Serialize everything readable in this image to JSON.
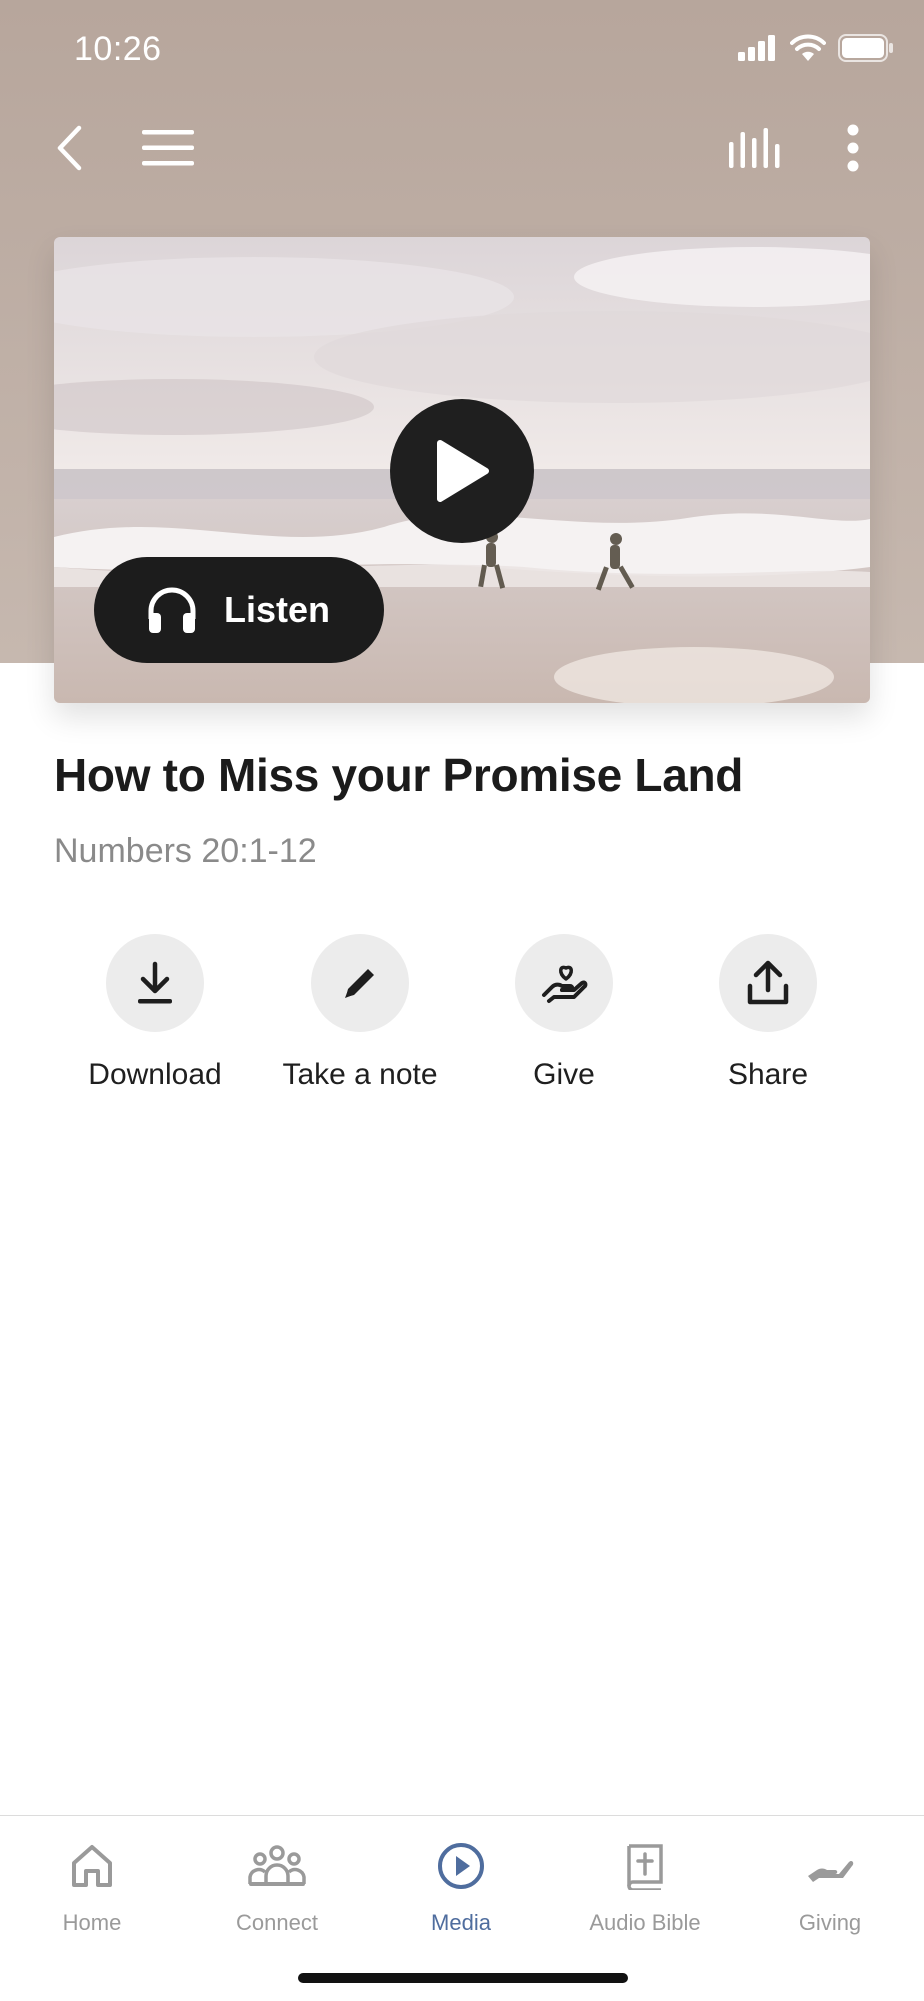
{
  "status_bar": {
    "time": "10:26"
  },
  "colors": {
    "header_bg": "#b9a99f",
    "active_tab": "#4f6d9e",
    "inactive_tab": "#9a9a9a"
  },
  "icons": {
    "back": "chevron-left-icon",
    "menu": "hamburger-menu-icon",
    "audio": "audio-bars-icon",
    "more": "vertical-dots-icon"
  },
  "media": {
    "listen_label": "Listen"
  },
  "sermon": {
    "title": "How to Miss your Promise Land",
    "scripture": "Numbers 20:1-12"
  },
  "actions": [
    {
      "label": "Download",
      "icon": "download-icon"
    },
    {
      "label": "Take a note",
      "icon": "pencil-icon"
    },
    {
      "label": "Give",
      "icon": "hand-heart-icon"
    },
    {
      "label": "Share",
      "icon": "share-icon"
    }
  ],
  "tabs": [
    {
      "label": "Home",
      "icon": "home-icon",
      "active": false
    },
    {
      "label": "Connect",
      "icon": "people-icon",
      "active": false
    },
    {
      "label": "Media",
      "icon": "play-circle-icon",
      "active": true
    },
    {
      "label": "Audio Bible",
      "icon": "bible-icon",
      "active": false
    },
    {
      "label": "Giving",
      "icon": "giving-hand-icon",
      "active": false
    }
  ]
}
